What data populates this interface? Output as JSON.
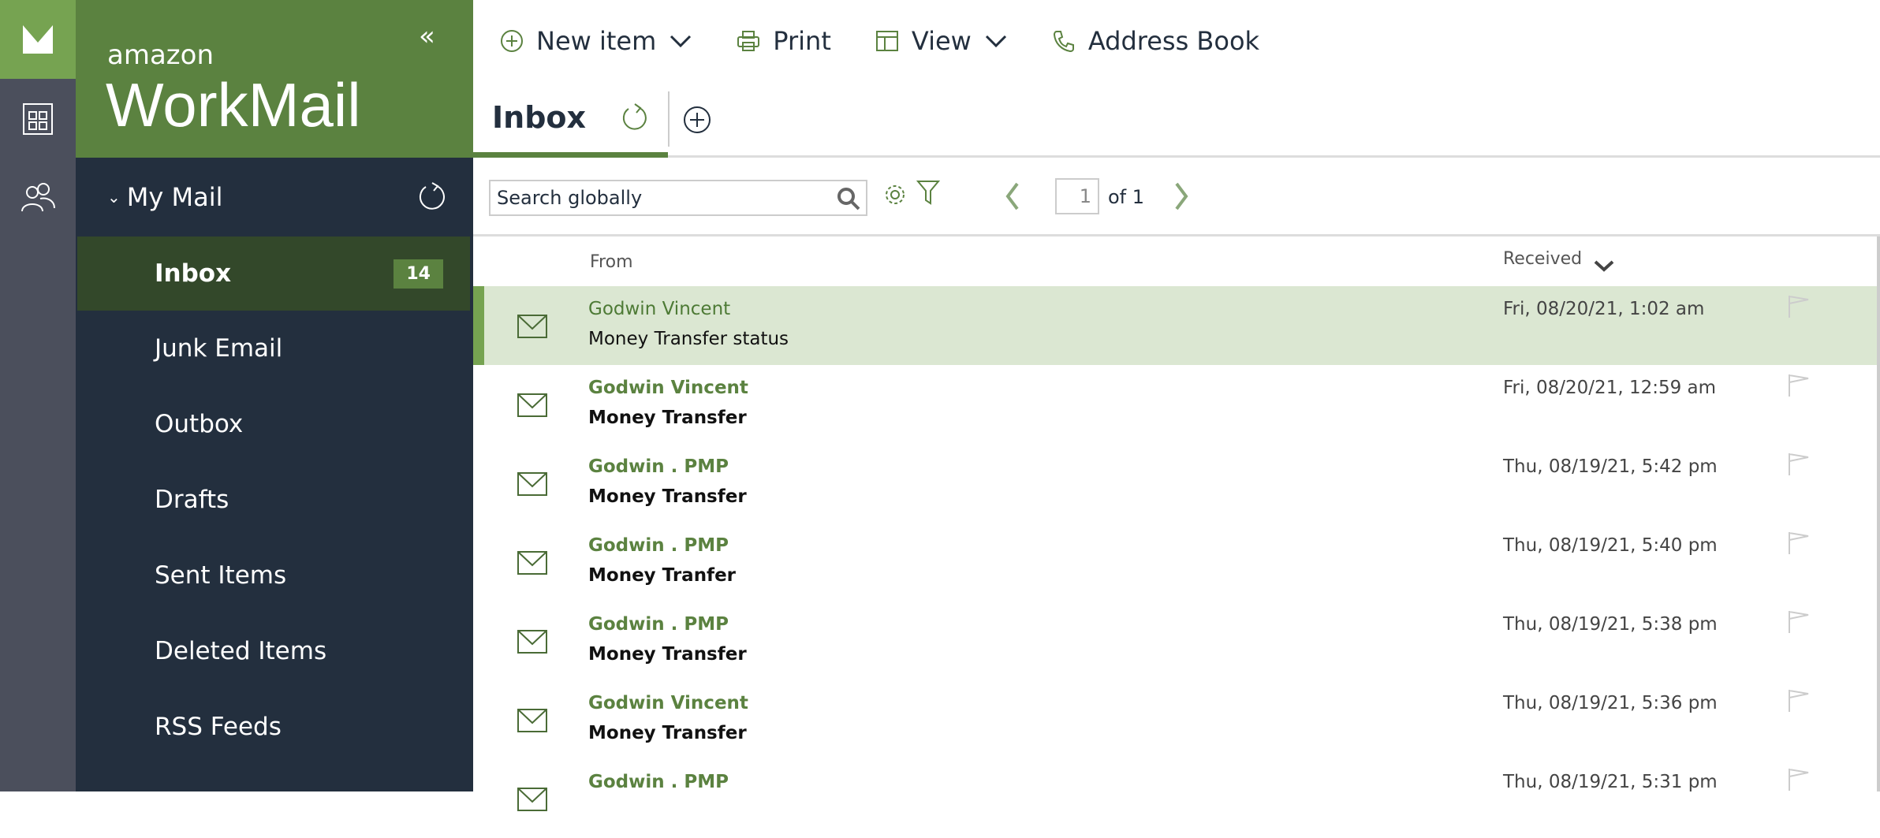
{
  "brand": {
    "small": "amazon",
    "large": "WorkMail"
  },
  "sidebar": {
    "section": "My Mail",
    "items": [
      {
        "label": "Inbox",
        "count": "14"
      },
      {
        "label": "Junk Email"
      },
      {
        "label": "Outbox"
      },
      {
        "label": "Drafts"
      },
      {
        "label": "Sent Items"
      },
      {
        "label": "Deleted Items"
      },
      {
        "label": "RSS Feeds"
      }
    ]
  },
  "toolbar": {
    "new_item": "New item",
    "print": "Print",
    "view": "View",
    "address_book": "Address Book"
  },
  "tab": {
    "label": "Inbox"
  },
  "search": {
    "placeholder": "Search globally"
  },
  "pagination": {
    "page": "1",
    "of": "of 1"
  },
  "columns": {
    "from": "From",
    "received": "Received"
  },
  "colors": {
    "accent": "#5b8240",
    "sidebar": "#232f3e",
    "selected_row": "#dbe7d2"
  },
  "messages": [
    {
      "from": "Godwin Vincent",
      "subject": "Money Transfer status",
      "received": "Fri, 08/20/21, 1:02 am"
    },
    {
      "from": "Godwin Vincent",
      "subject": "Money Transfer",
      "received": "Fri, 08/20/21, 12:59 am"
    },
    {
      "from": "Godwin . PMP",
      "subject": "Money Transfer",
      "received": "Thu, 08/19/21, 5:42 pm"
    },
    {
      "from": "Godwin . PMP",
      "subject": "Money Tranfer",
      "received": "Thu, 08/19/21, 5:40 pm"
    },
    {
      "from": "Godwin . PMP",
      "subject": "Money Transfer",
      "received": "Thu, 08/19/21, 5:38 pm"
    },
    {
      "from": "Godwin Vincent",
      "subject": "Money Transfer",
      "received": "Thu, 08/19/21, 5:36 pm"
    },
    {
      "from": "Godwin . PMP",
      "received": "Thu, 08/19/21, 5:31 pm"
    }
  ]
}
